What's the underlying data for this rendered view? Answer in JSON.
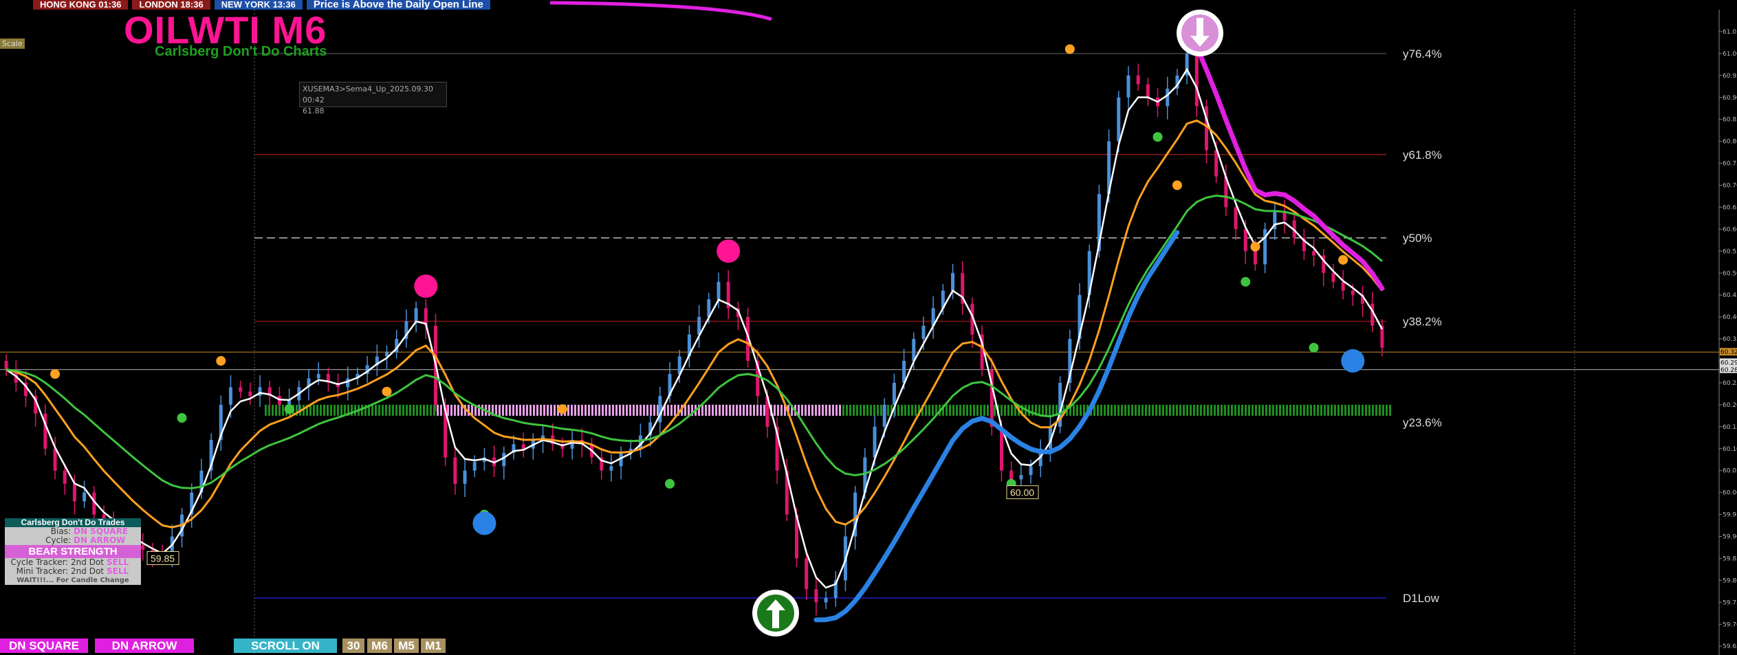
{
  "header": {
    "sessions": [
      {
        "label": "HONG KONG 01:36",
        "color": "#8b1a1a"
      },
      {
        "label": "LONDON  18:36",
        "color": "#8b1a1a"
      },
      {
        "label": "NEW YORK 13:36",
        "color": "#1e4fa8"
      }
    ],
    "banner": "Price is Above the Daily Open Line",
    "title": "OILWTI M6",
    "subtitle": "Carlsberg Don't Do Charts",
    "scale_label": "Scale"
  },
  "tooltip": {
    "line1": "XUSEMA3>Sema4_Up_2025.09.30 00:42",
    "line2": "61.88"
  },
  "panel": {
    "header": "Carlsberg Don't Do Trades",
    "bias_label": "Bias:",
    "bias_value": "DN SQUARE",
    "cycle_label": "Cycle:",
    "cycle_value": "DN ARROW",
    "strength": "BEAR STRENGTH",
    "cycle_tracker_label": "Cycle Tracker: 2nd Dot",
    "cycle_tracker_value": "SELL",
    "mini_tracker_label": "Mini Tracker: 2nd Dot",
    "mini_tracker_value": "SELL",
    "wait": "WAIT!!!... For Candle Change"
  },
  "bottom": {
    "dn_square": "DN SQUARE",
    "dn_arrow": "DN ARROW",
    "scroll": "SCROLL ON",
    "tf": [
      "30",
      "M6",
      "M5",
      "M1"
    ]
  },
  "chart_data": {
    "type": "candlestick",
    "symbol": "OILWTI",
    "timeframe": "M6",
    "ylim": [
      59.63,
      61.1
    ],
    "y_ticks": [
      "61.05",
      "61.00",
      "60.95",
      "60.90",
      "60.85",
      "60.80",
      "60.75",
      "60.70",
      "60.65",
      "60.60",
      "60.55",
      "60.50",
      "60.45",
      "60.40",
      "60.35",
      "60.30",
      "60.25",
      "60.20",
      "60.15",
      "60.10",
      "60.05",
      "60.00",
      "59.95",
      "59.90",
      "59.85",
      "59.80",
      "59.75",
      "59.70",
      "59.65"
    ],
    "fib_levels": [
      {
        "label": "y76.4%",
        "value": 61.0
      },
      {
        "label": "y61.8%",
        "value": 60.77
      },
      {
        "label": "y50%",
        "value": 60.58
      },
      {
        "label": "y38.2%",
        "value": 60.39
      },
      {
        "label": "y23.6%",
        "value": 60.16
      },
      {
        "label": "D1Low",
        "value": 59.76
      }
    ],
    "price_tags": [
      {
        "label": "59.85",
        "value": 59.85
      },
      {
        "label": "60.00",
        "value": 60.0
      }
    ],
    "axis_price_marks": [
      "60.32",
      "60.29",
      "60.28"
    ],
    "colors": {
      "bull": "#4a90d9",
      "bear": "#e0156e",
      "white_ma": "#ffffff",
      "orange_ma": "#ffa020",
      "green_ma": "#3ec43e",
      "blue_ma": "#2a82e4",
      "magenta_ma": "#e020e0",
      "fib_red": "#8b1a1a",
      "d1low": "#1e1ec8"
    },
    "closes": [
      60.28,
      60.25,
      60.22,
      60.18,
      60.1,
      60.05,
      60.02,
      59.98,
      60.0,
      59.95,
      59.93,
      59.92,
      59.9,
      59.88,
      59.87,
      59.86,
      59.85,
      59.9,
      59.95,
      60.0,
      60.05,
      60.12,
      60.2,
      60.24,
      60.23,
      60.22,
      60.24,
      60.22,
      60.2,
      60.21,
      60.24,
      60.26,
      60.27,
      60.25,
      60.24,
      60.26,
      60.27,
      60.29,
      60.31,
      60.32,
      60.35,
      60.39,
      60.42,
      60.38,
      60.2,
      60.08,
      60.02,
      60.05,
      60.07,
      60.08,
      60.06,
      60.09,
      60.11,
      60.1,
      60.12,
      60.13,
      60.11,
      60.1,
      60.12,
      60.11,
      60.08,
      60.05,
      60.06,
      60.09,
      60.1,
      60.13,
      60.16,
      60.22,
      60.27,
      60.31,
      60.36,
      60.4,
      60.44,
      60.48,
      60.42,
      60.4,
      60.3,
      60.22,
      60.15,
      60.05,
      59.95,
      59.85,
      59.78,
      59.75,
      59.76,
      59.8,
      59.9,
      60.0,
      60.08,
      60.15,
      60.2,
      60.25,
      60.3,
      60.35,
      60.38,
      60.42,
      60.46,
      60.5,
      60.43,
      60.36,
      60.28,
      60.15,
      60.05,
      60.03,
      60.04,
      60.06,
      60.1,
      60.15,
      60.25,
      60.35,
      60.45,
      60.55,
      60.68,
      60.8,
      60.9,
      60.95,
      60.93,
      60.9,
      60.88,
      60.92,
      60.95,
      61.0,
      60.88,
      60.78,
      60.72,
      60.65,
      60.6,
      60.55,
      60.52,
      60.6,
      60.64,
      60.62,
      60.58,
      60.55,
      60.54,
      60.5,
      60.48,
      60.46,
      60.45,
      60.43,
      60.38,
      60.33
    ]
  }
}
